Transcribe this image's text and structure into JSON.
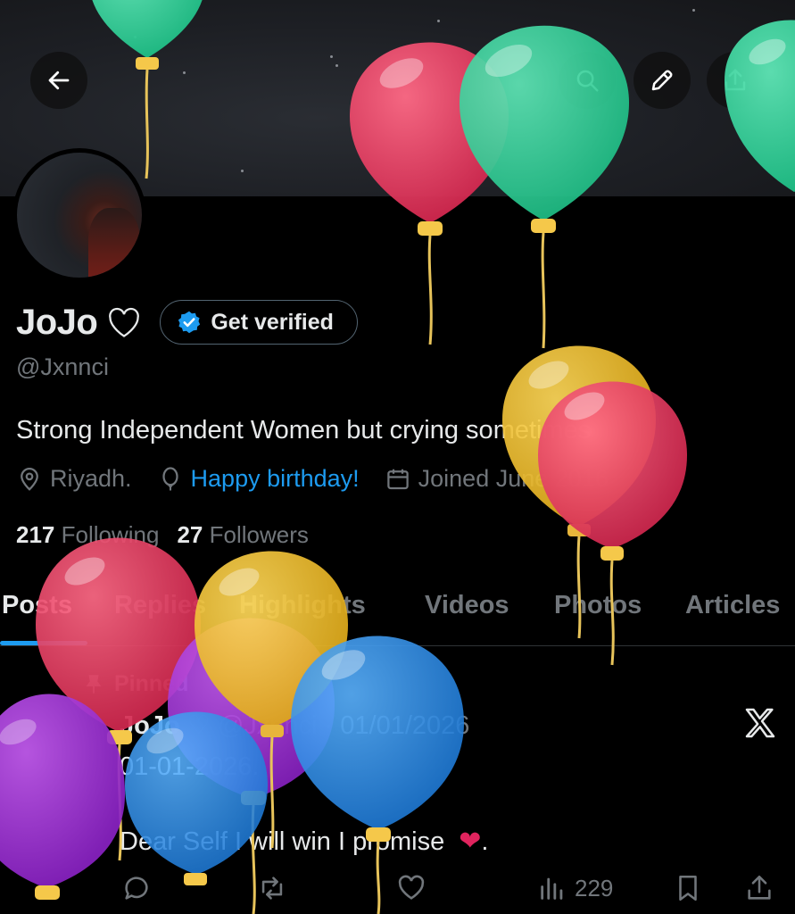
{
  "profile": {
    "name": "JoJo",
    "name_heart": "♡",
    "get_verified_label": "Get verified",
    "handle": "@Jxnnci",
    "bio": "Strong Independent Women but crying sometimes",
    "location": "Riyadh.",
    "birthday_label": "Happy birthday!",
    "joined": "Joined June 2016",
    "following_count": "217",
    "following_label": "Following",
    "followers_count": "27",
    "followers_label": "Followers"
  },
  "tabs": [
    "Posts",
    "Replies",
    "Highlights",
    "Videos",
    "Photos",
    "Articles"
  ],
  "active_tab": "Posts",
  "post": {
    "pinned_label": "Pinned",
    "author": "JoJo",
    "author_heart": "♡",
    "handle": "@Jxnnci",
    "date": "01/01/2026",
    "line1": "01-01-2026.",
    "line2": "Dear Self I will win I promise",
    "line2_tail": ".",
    "views": "229"
  },
  "colors": {
    "accent": "#1d9bf0",
    "muted": "#71767b",
    "text": "#e7e9ea",
    "background": "#000000",
    "balloon_red": "#e23a5e",
    "balloon_green": "#2fd29a",
    "balloon_yellow": "#f0c22e",
    "balloon_blue": "#2f8fe6",
    "balloon_purple": "#a03ad6"
  },
  "icons": [
    "back-arrow-icon",
    "search-icon",
    "edit-pencil-icon",
    "share-icon",
    "verified-badge-icon",
    "location-icon",
    "balloon-icon",
    "calendar-icon",
    "pin-icon",
    "x-logo-icon",
    "reply-icon",
    "repost-icon",
    "like-icon",
    "views-icon",
    "bookmark-icon",
    "share-post-icon"
  ]
}
